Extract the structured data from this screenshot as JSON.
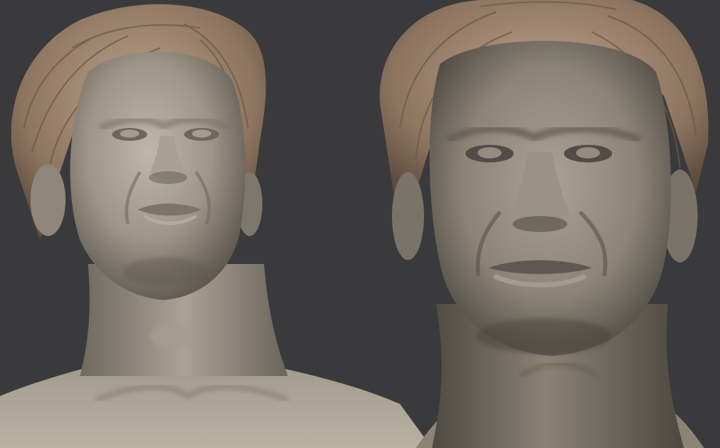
{
  "image": {
    "subject": "two-sculpt-render-views",
    "views": [
      {
        "view_name": "three-quarter-low-angle-view"
      },
      {
        "view_name": "frontal-close-up-view"
      }
    ]
  },
  "colors": {
    "background": "#3a3a3c",
    "clay_light": "#b3ab9c",
    "clay_mid": "#958d7f",
    "clay_dark": "#5e5850",
    "hair_light": "#b79f86",
    "hair_dark": "#6f5a47"
  }
}
